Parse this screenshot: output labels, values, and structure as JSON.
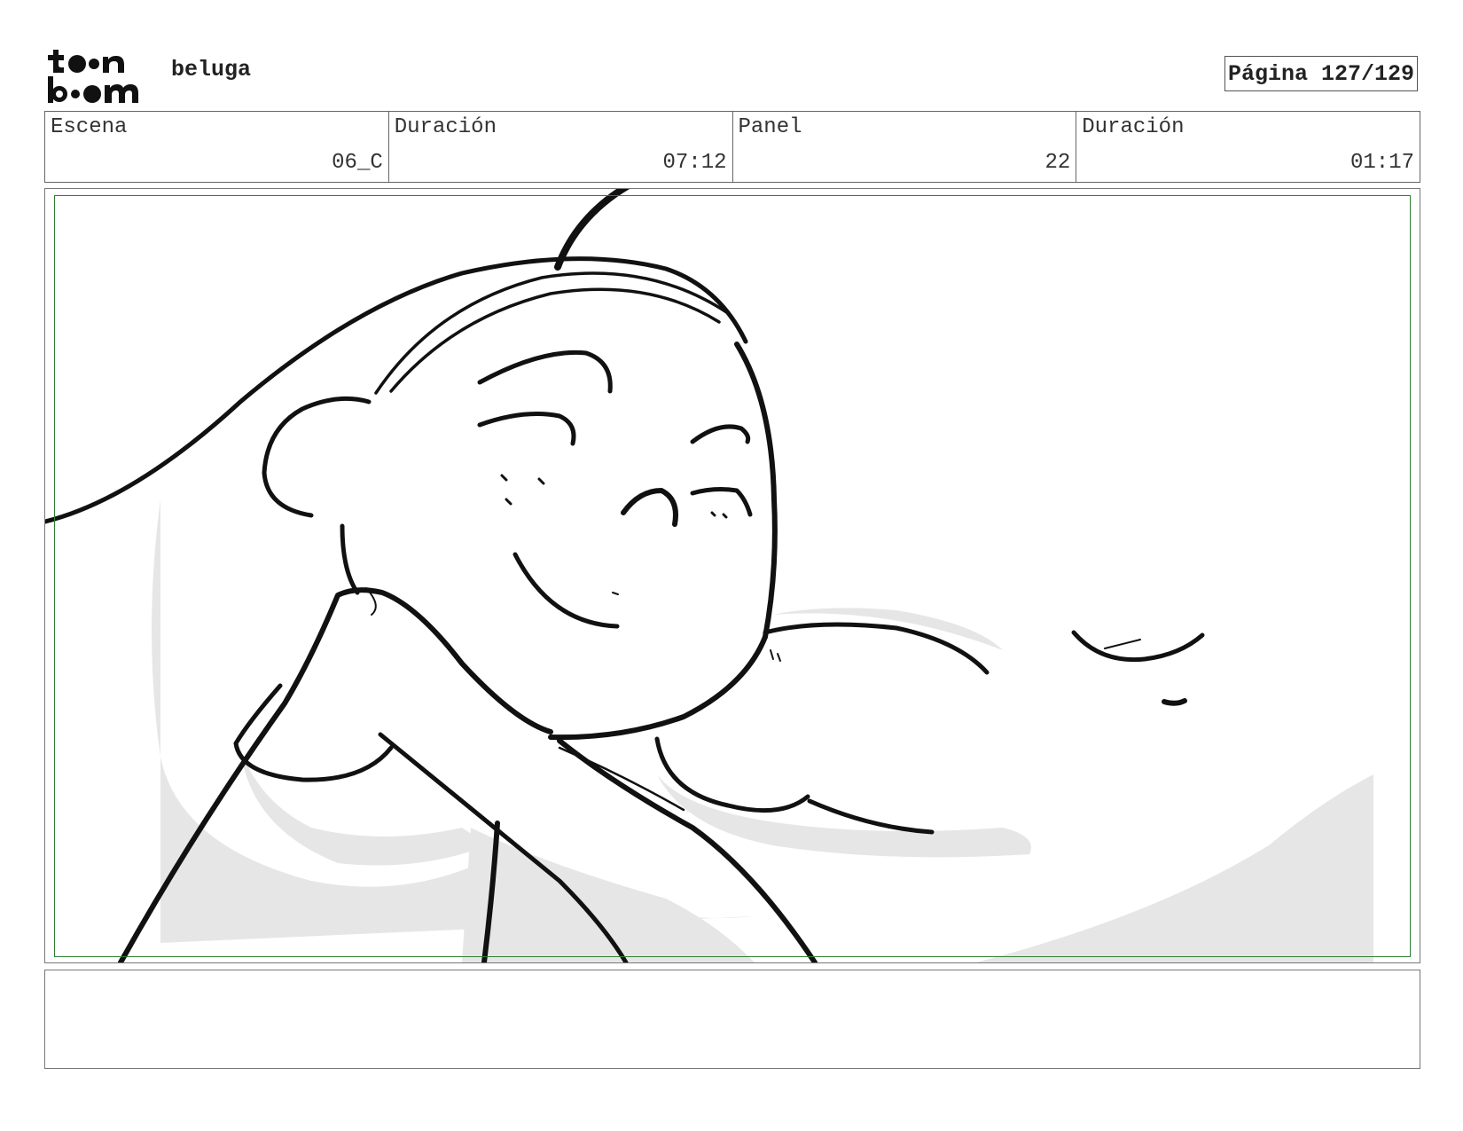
{
  "header": {
    "project_title": "beluga",
    "page_label": "Página 127/129"
  },
  "info": {
    "scene_label": "Escena",
    "scene_value": "06_C",
    "scene_duration_label": "Duración",
    "scene_duration_value": "07:12",
    "panel_label": "Panel",
    "panel_value": "22",
    "panel_duration_label": "Duración",
    "panel_duration_value": "01:17"
  },
  "panel": {
    "safe_frame_color": "#2e7d32"
  },
  "notes": {
    "text": ""
  }
}
